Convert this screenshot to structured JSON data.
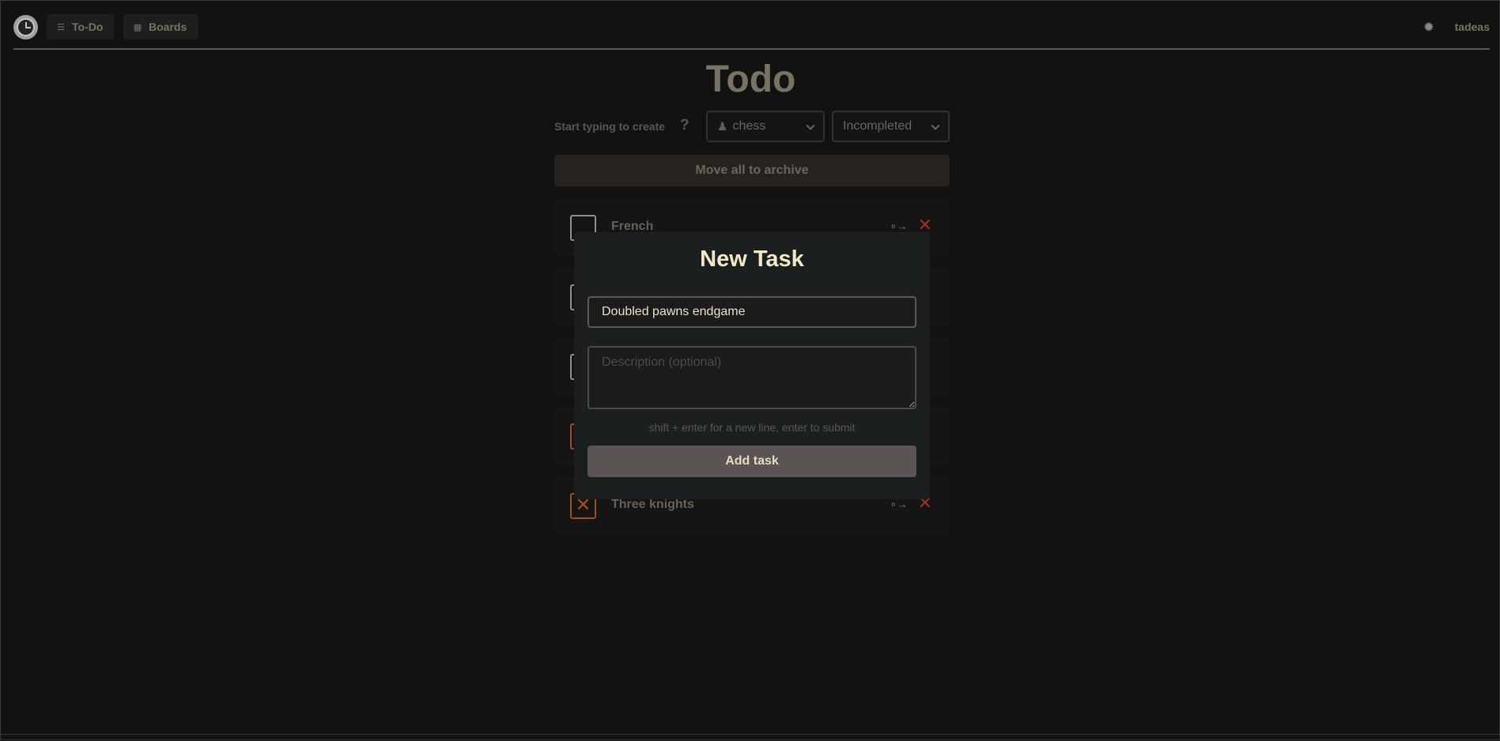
{
  "header": {
    "logo_icon": "clock-logo-icon",
    "nav": [
      {
        "label": "To-Do",
        "icon": "list-check-icon"
      },
      {
        "label": "Boards",
        "icon": "grid-icon"
      }
    ],
    "settings_icon": "sun-gear-icon",
    "username": "tadeas"
  },
  "main": {
    "title": "Todo",
    "create_hint": "Start typing to create",
    "help_label": "?",
    "board_select": {
      "icon": "pawn-icon",
      "value": "chess"
    },
    "status_select": {
      "value": "Incompleted"
    },
    "archive_button": "Move all to archive",
    "tasks": [
      {
        "name": "French",
        "done": false
      },
      {
        "name": "",
        "done": false
      },
      {
        "name": "",
        "done": false
      },
      {
        "name": "",
        "done": true
      },
      {
        "name": "Three knights",
        "done": true
      }
    ]
  },
  "modal": {
    "title": "New Task",
    "name_value": "Doubled pawns endgame",
    "description_placeholder": "Description (optional)",
    "hint": "shift + enter for a new line, enter to submit",
    "submit_label": "Add task"
  },
  "colors": {
    "accent_done": "#b8601f",
    "delete": "#c1331f",
    "modal_title": "#f4e7c3"
  }
}
